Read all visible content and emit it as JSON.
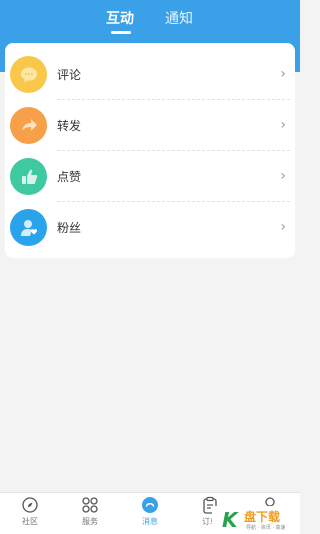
{
  "header": {
    "tabs": [
      {
        "label": "互动",
        "active": true
      },
      {
        "label": "通知",
        "active": false
      }
    ],
    "color": "#3aa0e8"
  },
  "list": {
    "items": [
      {
        "label": "评论",
        "icon": "chat-bubble-icon",
        "color": "#f9c84a"
      },
      {
        "label": "转发",
        "icon": "share-arrow-icon",
        "color": "#f7a04a"
      },
      {
        "label": "点赞",
        "icon": "thumbs-up-icon",
        "color": "#3ec9a1"
      },
      {
        "label": "粉丝",
        "icon": "fan-user-icon",
        "color": "#29a3ea"
      }
    ]
  },
  "bottom_nav": {
    "items": [
      {
        "label": "社区",
        "icon": "compass-icon",
        "active": false
      },
      {
        "label": "服务",
        "icon": "grid-petals-icon",
        "active": false
      },
      {
        "label": "消息",
        "icon": "message-icon",
        "active": true
      },
      {
        "label": "订单",
        "icon": "clipboard-icon",
        "active": false
      },
      {
        "label": "",
        "icon": "profile-icon",
        "active": false
      }
    ]
  },
  "watermark": {
    "logo": "K",
    "text": "盘下载",
    "sub": "导航 · 资讯 · 高速"
  }
}
